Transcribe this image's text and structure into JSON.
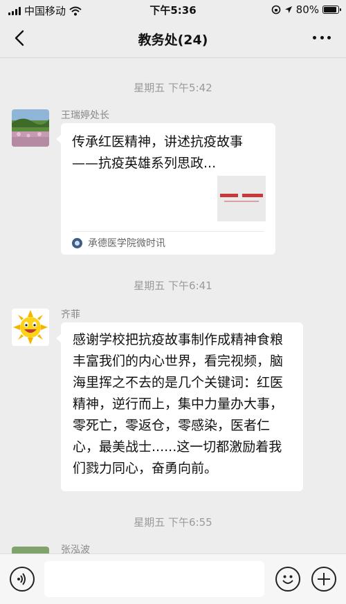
{
  "status_bar": {
    "carrier": "中国移动",
    "time": "下午5:36",
    "battery": "80%",
    "battery_level": 0.8,
    "icons": [
      "signal-icon",
      "wifi-icon",
      "orientation-lock-icon",
      "location-icon",
      "battery-icon"
    ]
  },
  "nav": {
    "back_icon": "chevron-left-icon",
    "title": "教务处(24)",
    "more_icon": "more-icon"
  },
  "messages": [
    {
      "timestamp": "星期五 下午5:42",
      "sender": "王瑞婷处长",
      "type": "link",
      "title": "传承红医精神，讲述抗疫故事——抗疫英雄系列思政...",
      "source": "承德医学院微时讯"
    },
    {
      "timestamp": "星期五 下午6:41",
      "sender": "齐菲",
      "type": "text",
      "text": "感谢学校把抗疫故事制作成精神食粮丰富我们的内心世界，看完视频，脑海里挥之不去的是几个关键词：红医精神，逆行而上，集中力量办大事，零死亡，零返仓，零感染，医者仁心，最美战士......这一切都激励着我们戮力同心，奋勇向前。"
    },
    {
      "timestamp": "星期五 下午6:55",
      "sender": "张泓波",
      "type": "partial"
    }
  ],
  "input_bar": {
    "voice_icon": "voice-icon",
    "emoji_icon": "emoji-icon",
    "plus_icon": "plus-icon",
    "value": ""
  },
  "colors": {
    "background": "#ededed",
    "bubble": "#ffffff",
    "timestamp": "#9a9a9a",
    "sender_name": "#888888"
  }
}
